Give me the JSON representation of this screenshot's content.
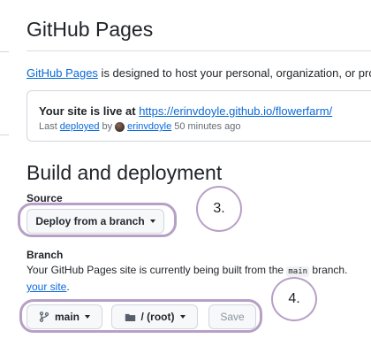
{
  "page": {
    "title": "GitHub Pages"
  },
  "intro": {
    "link_text": "GitHub Pages",
    "text": " is designed to host your personal, organization, or pro"
  },
  "live_site": {
    "prefix": "Your site is live at ",
    "url": "https://erinvdoyle.github.io/flowerfarm/",
    "meta_last": "Last ",
    "meta_deployed": "deployed",
    "meta_by": " by ",
    "meta_user": "erinvdoyle",
    "meta_time": " 50 minutes ago"
  },
  "build": {
    "title": "Build and deployment",
    "source_label": "Source",
    "source_button": "Deploy from a branch",
    "branch_label": "Branch",
    "branch_text_1": "Your GitHub Pages site is currently being built from the ",
    "branch_code": "main",
    "branch_text_2": " branch.",
    "branch_link": "your site",
    "branch_link_suffix": ".",
    "branch_button": "main",
    "folder_button": "/ (root)",
    "save_button": "Save"
  },
  "annotations": {
    "step3": "3.",
    "step4": "4.",
    "color": "#b7a0c6"
  },
  "icons": {
    "branch": "git-branch-icon",
    "folder": "folder-icon",
    "caret": "triangle-down-icon",
    "avatar": "user-avatar"
  }
}
